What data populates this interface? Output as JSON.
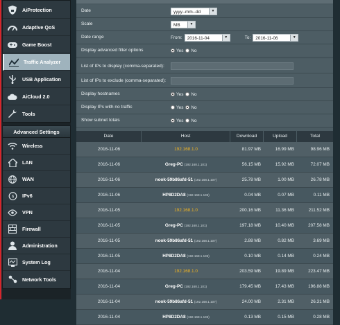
{
  "sidebar": {
    "top_items": [
      {
        "label": "AiProtection",
        "icon": "shield-lock-icon"
      },
      {
        "label": "Adaptive QoS",
        "icon": "speedometer-icon"
      },
      {
        "label": "Game Boost",
        "icon": "gamepad-icon"
      },
      {
        "label": "Traffic Analyzer",
        "icon": "traffic-chart-icon",
        "active": true
      },
      {
        "label": "USB Application",
        "icon": "usb-icon"
      },
      {
        "label": "AiCloud 2.0",
        "icon": "cloud-icon"
      },
      {
        "label": "Tools",
        "icon": "wrench-icon"
      }
    ],
    "advanced_title": "Advanced Settings",
    "advanced_items": [
      {
        "label": "Wireless",
        "icon": "wifi-icon"
      },
      {
        "label": "LAN",
        "icon": "home-network-icon"
      },
      {
        "label": "WAN",
        "icon": "globe-icon"
      },
      {
        "label": "IPv6",
        "icon": "ipv6-icon"
      },
      {
        "label": "VPN",
        "icon": "vpn-icon"
      },
      {
        "label": "Firewall",
        "icon": "firewall-icon"
      },
      {
        "label": "Administration",
        "icon": "admin-user-icon"
      },
      {
        "label": "System Log",
        "icon": "system-log-icon"
      },
      {
        "label": "Network Tools",
        "icon": "network-tools-icon"
      }
    ]
  },
  "form": {
    "date_label": "Date",
    "date_value": "yyyy--mm--dd",
    "scale_label": "Scale",
    "scale_value": "MB",
    "date_range_label": "Date range",
    "from_label": "From:",
    "from_value": "2016-11-04",
    "to_label": "To:",
    "to_value": "2016-11-06",
    "adv_filter_label": "Display advanced filter options",
    "ips_display_label": "List of IPs to display (comma-separated):",
    "ips_exclude_label": "List of IPs to exclude (comma-separated):",
    "hostnames_label": "Display hostnames",
    "no_traffic_label": "Display IPs with no traffic",
    "subnet_label": "Show subnet totals",
    "yes_label": "Yes",
    "no_label": "No"
  },
  "radios": {
    "adv_filter": "yes",
    "hostnames": "yes",
    "no_traffic": "no",
    "subnet": "yes"
  },
  "table": {
    "headers": [
      "Date",
      "Host",
      "Download",
      "Upload",
      "Total"
    ],
    "rows": [
      {
        "date": "2016-11-06",
        "host": "192.168.1.0",
        "sub": "",
        "download": "81.97 MB",
        "upload": "16.99 MB",
        "total": "98.96 MB"
      },
      {
        "date": "2016-11-06",
        "host": "Greg-PC",
        "sub": "(192.168.1.101)",
        "download": "56.15 MB",
        "upload": "15.92 MB",
        "total": "72.07 MB"
      },
      {
        "date": "2016-11-06",
        "host": "nook-59b86afd-51",
        "sub": "(192.168.1.107)",
        "download": "25.78 MB",
        "upload": "1.00 MB",
        "total": "26.78 MB"
      },
      {
        "date": "2016-11-06",
        "host": "HP8D2DA8",
        "sub": "(192.168.1.135)",
        "download": "0.04 MB",
        "upload": "0.07 MB",
        "total": "0.11 MB"
      },
      {
        "date": "2016-11-05",
        "host": "192.168.1.0",
        "sub": "",
        "download": "200.16 MB",
        "upload": "11.36 MB",
        "total": "211.52 MB"
      },
      {
        "date": "2016-11-05",
        "host": "Greg-PC",
        "sub": "(192.168.1.101)",
        "download": "197.18 MB",
        "upload": "10.40 MB",
        "total": "207.58 MB"
      },
      {
        "date": "2016-11-05",
        "host": "nook-59b86afd-51",
        "sub": "(192.168.1.107)",
        "download": "2.88 MB",
        "upload": "0.82 MB",
        "total": "3.69 MB"
      },
      {
        "date": "2016-11-05",
        "host": "HP8D2DA8",
        "sub": "(192.168.1.135)",
        "download": "0.10 MB",
        "upload": "0.14 MB",
        "total": "0.24 MB"
      },
      {
        "date": "2016-11-04",
        "host": "192.168.1.0",
        "sub": "",
        "download": "203.59 MB",
        "upload": "19.89 MB",
        "total": "223.47 MB"
      },
      {
        "date": "2016-11-04",
        "host": "Greg-PC",
        "sub": "(192.168.1.101)",
        "download": "179.45 MB",
        "upload": "17.43 MB",
        "total": "196.88 MB"
      },
      {
        "date": "2016-11-04",
        "host": "nook-59b86afd-51",
        "sub": "(192.168.1.107)",
        "download": "24.00 MB",
        "upload": "2.31 MB",
        "total": "26.31 MB"
      },
      {
        "date": "2016-11-04",
        "host": "HP8D2DA8",
        "sub": "(192.168.1.135)",
        "download": "0.13 MB",
        "upload": "0.15 MB",
        "total": "0.28 MB"
      }
    ]
  },
  "colors": {
    "accent_red": "#d6262c",
    "subnet_host": "#f0b423",
    "panel": "#4b5b62",
    "sidebar": "#2d3940"
  }
}
